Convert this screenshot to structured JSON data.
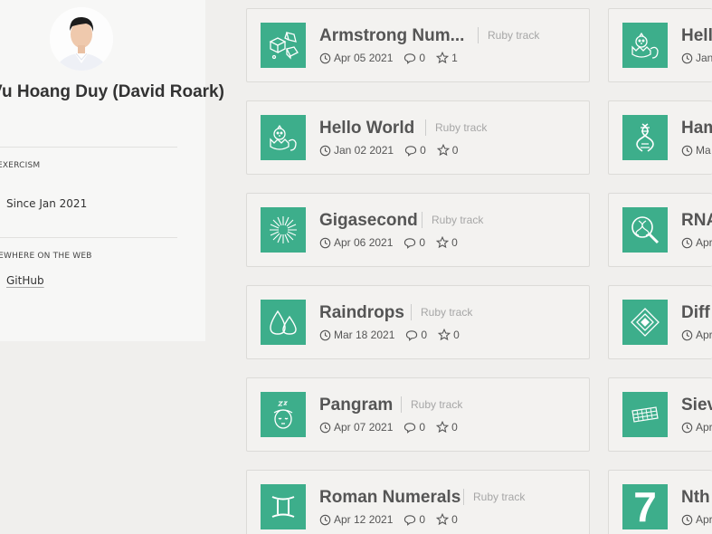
{
  "profile": {
    "name": "Vu Hoang Duy (David Roark)",
    "sections": [
      {
        "label": "EXERCISM",
        "value": "Since Jan 2021"
      },
      {
        "label": "SOMEWHERE ON THE WEB",
        "value": "GitHub"
      }
    ]
  },
  "left_column": [
    {
      "title": "Armstrong Num...",
      "track": "Ruby track",
      "date": "Apr 05 2021",
      "comments": "0",
      "stars": "1",
      "icon": "dice-icon"
    },
    {
      "title": "Hello World",
      "track": "Ruby track",
      "date": "Jan 02 2021",
      "comments": "0",
      "stars": "0",
      "icon": "hatching-chick-icon"
    },
    {
      "title": "Gigasecond",
      "track": "Ruby track",
      "date": "Apr 06 2021",
      "comments": "0",
      "stars": "0",
      "icon": "firework-icon"
    },
    {
      "title": "Raindrops",
      "track": "Ruby track",
      "date": "Mar 18 2021",
      "comments": "0",
      "stars": "0",
      "icon": "droplets-icon"
    },
    {
      "title": "Pangram",
      "track": "Ruby track",
      "date": "Apr 07 2021",
      "comments": "0",
      "stars": "0",
      "icon": "sleeping-face-icon"
    },
    {
      "title": "Roman Numerals",
      "track": "Ruby track",
      "date": "Apr 12 2021",
      "comments": "0",
      "stars": "0",
      "icon": "gemini-icon"
    }
  ],
  "right_column": [
    {
      "title": "Hell",
      "date": "Jan",
      "icon": "hatching-chick-icon"
    },
    {
      "title": "Ham",
      "date": "Ma",
      "icon": "dna-icon"
    },
    {
      "title": "RNA",
      "date": "Apr",
      "icon": "dna-magnifier-icon"
    },
    {
      "title": "Diff",
      "date": "Apr",
      "icon": "diamond-pattern-icon"
    },
    {
      "title": "Siev",
      "date": "Apr",
      "icon": "sieve-icon"
    },
    {
      "title": "Nth",
      "date": "Apr",
      "icon": "seven-icon",
      "icon_text": "7"
    }
  ],
  "colors": {
    "accent": "#3dae8b",
    "card_bg": "#f3f2f0",
    "page_bg": "#f0efed"
  }
}
